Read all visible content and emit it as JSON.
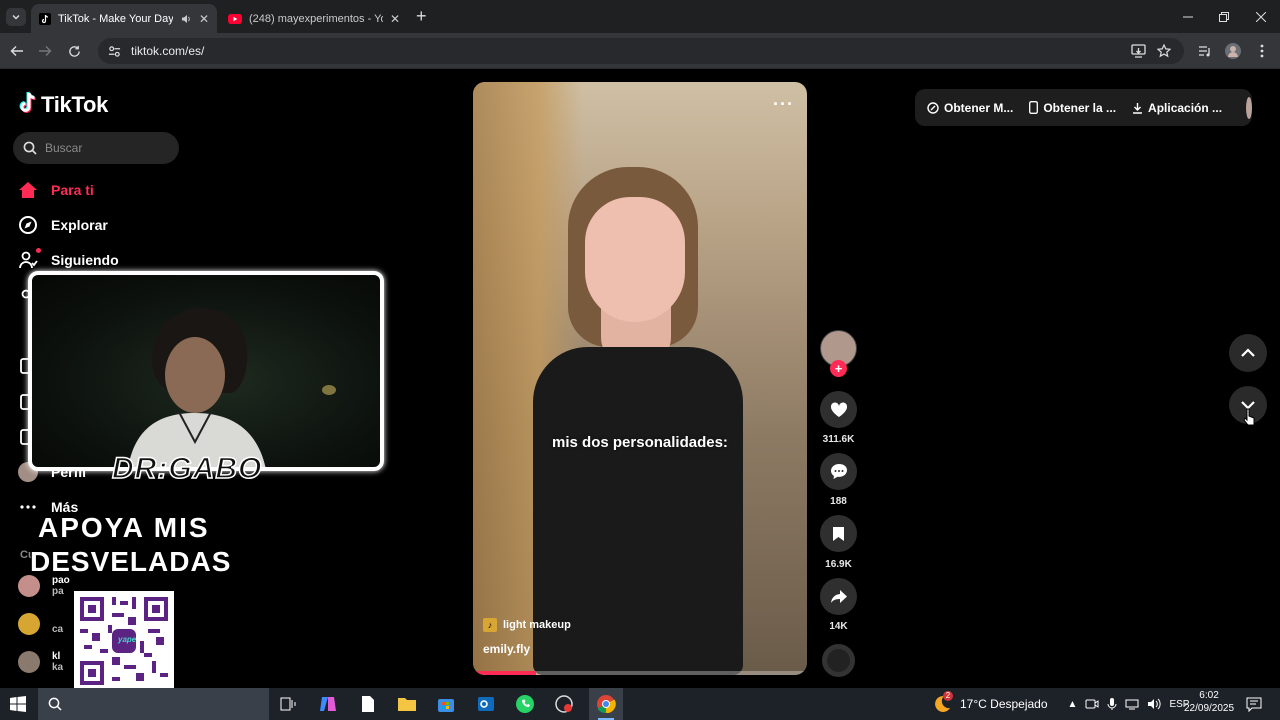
{
  "browser": {
    "tabs": [
      {
        "title": "TikTok - Make Your Day",
        "active": true
      },
      {
        "title": "(248) mayexperimentos - YouTube",
        "active": false
      }
    ],
    "url": "tiktok.com/es/"
  },
  "tiktok": {
    "logo": "TikTok",
    "search_placeholder": "Buscar",
    "nav": [
      {
        "label": "Para ti",
        "icon": "home-icon",
        "active": true
      },
      {
        "label": "Explorar",
        "icon": "compass-icon",
        "active": false
      },
      {
        "label": "Siguiendo",
        "icon": "following-icon",
        "active": false
      },
      {
        "label": "Perfil",
        "icon": "profile-icon",
        "active": false
      },
      {
        "label": "Más",
        "icon": "more-icon",
        "active": false
      }
    ],
    "suggested_title": "Cu",
    "suggested": [
      {
        "line1": "pao",
        "line2": "pa"
      },
      {
        "line1": "",
        "line2": "ca"
      },
      {
        "line1": "kl",
        "line2": "ka"
      }
    ],
    "video": {
      "caption": "mis dos personalidades:",
      "music": "light makeup",
      "author": "emily.fly",
      "progress": 0.19
    },
    "actions": {
      "likes": "311.6K",
      "comments": "188",
      "saves": "16.9K",
      "shares": "14K"
    },
    "topbar": [
      "Obtener M...",
      "Obtener la ...",
      "Aplicación ..."
    ]
  },
  "overlay": {
    "streamer": "DR:GABO",
    "promo_line1": "APOYA MIS",
    "promo_line2": "DESVELADAS",
    "qr_label": "yape"
  },
  "taskbar": {
    "weather_badge": "2",
    "weather": "17°C  Despejado",
    "lang": "ESP",
    "time": "6:02",
    "date": "22/09/2025"
  }
}
